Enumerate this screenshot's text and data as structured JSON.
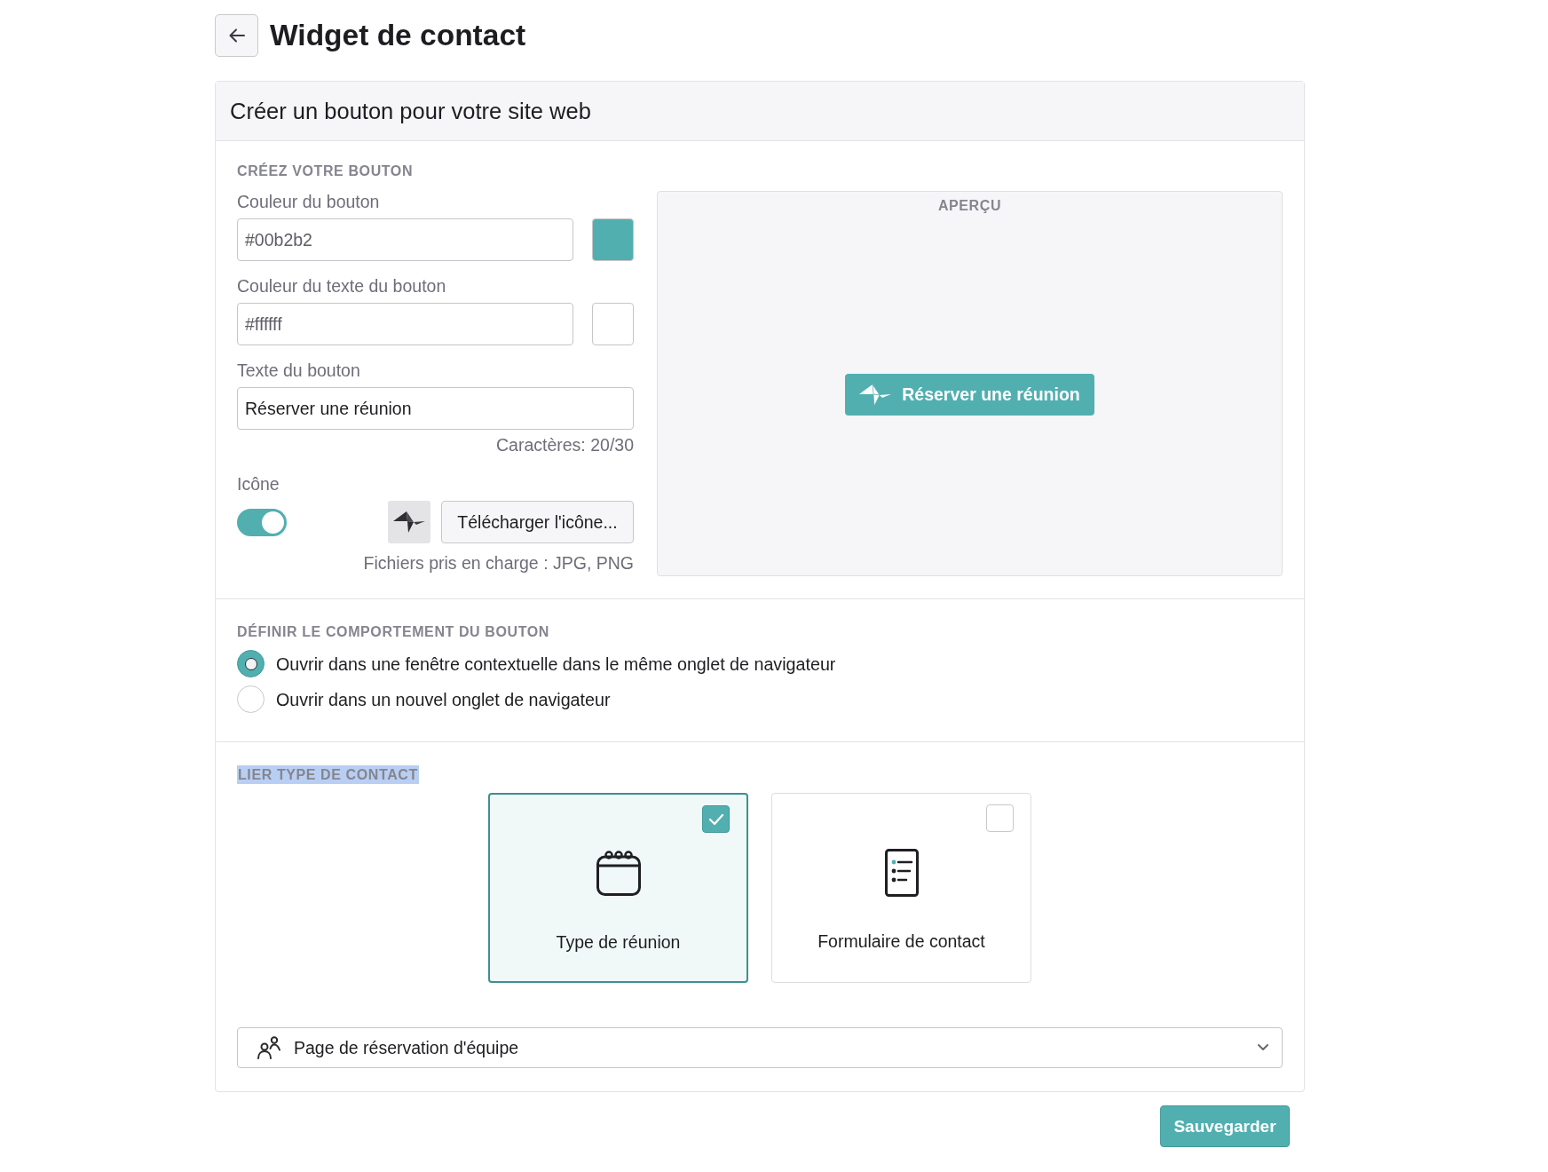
{
  "header": {
    "title": "Widget de contact"
  },
  "card": {
    "title": "Créer un bouton pour votre site web"
  },
  "create_section": {
    "heading": "CRÉEZ VOTRE BOUTON",
    "color_fields": [
      {
        "label": "Couleur du bouton",
        "value": "#00b2b2",
        "color": "#52afb0"
      },
      {
        "label": "Couleur du texte du bouton",
        "value": "#ffffff",
        "color": "#ffffff"
      }
    ],
    "text_field": {
      "label": "Texte du bouton",
      "value": "Réserver une réunion",
      "counter": "Caractères: 20/30"
    },
    "icon": {
      "label": "Icône",
      "on": true,
      "upload_button": "Télécharger l'icône...",
      "hint": "Fichiers pris en charge : JPG, PNG"
    }
  },
  "preview": {
    "heading": "APERÇU",
    "button_label": "Réserver une réunion"
  },
  "behavior": {
    "heading": "DÉFINIR LE COMPORTEMENT DU BOUTON",
    "options": [
      {
        "label": "Ouvrir dans une fenêtre contextuelle dans le même onglet de navigateur",
        "selected": true
      },
      {
        "label": "Ouvrir dans un nouvel onglet de navigateur",
        "selected": false
      }
    ]
  },
  "contact": {
    "heading": "LIER TYPE DE CONTACT",
    "heading_highlighted": true,
    "types": [
      {
        "label": "Type de réunion",
        "selected": true
      },
      {
        "label": "Formulaire de contact",
        "selected": false
      }
    ],
    "dropdown": {
      "value": "Page de réservation d'équipe"
    }
  },
  "save_button": "Sauvegarder"
}
